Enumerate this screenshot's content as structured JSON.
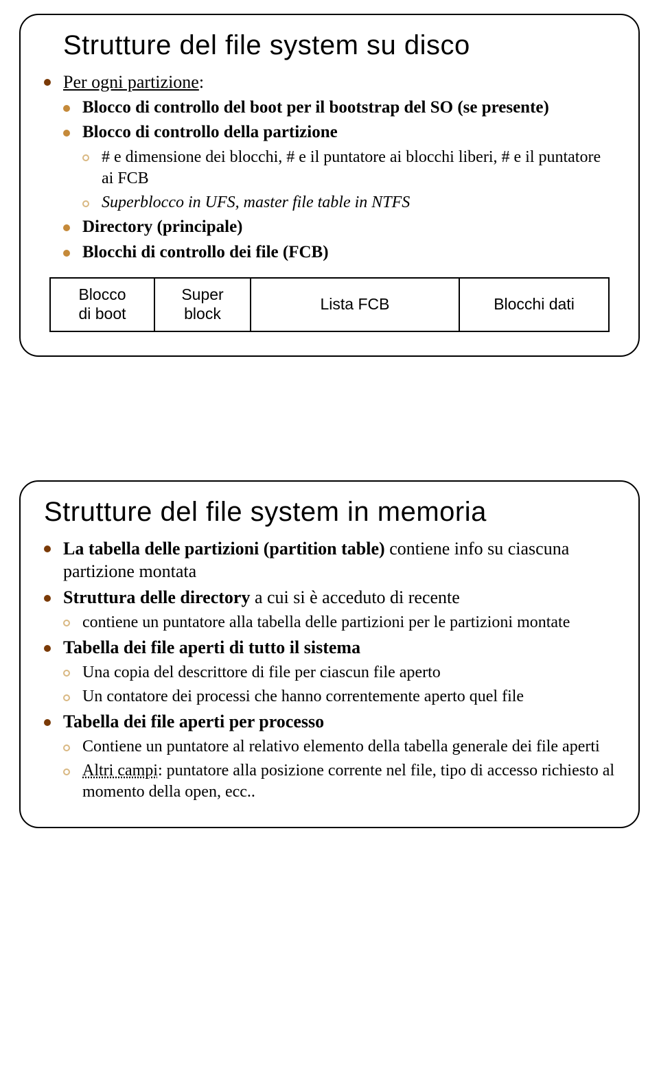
{
  "slide1": {
    "title": "Strutture del file system su disco",
    "l1_intro_prefix": "Per ogni partizione",
    "l1_intro_suffix": ":",
    "l2_boot": "Blocco di controllo del boot per il bootstrap del SO (se presente)",
    "l2_part": "Blocco di controllo della partizione",
    "l3_dims": "# e dimensione dei blocchi, # e il puntatore ai blocchi liberi, # e il puntatore ai FCB",
    "l3_superblock": "Superblocco in UFS, master file table in NTFS",
    "l2_dir": "Directory (principale)",
    "l2_fcb": "Blocchi di controllo dei file (FCB)",
    "disk": {
      "c1a": "Blocco",
      "c1b": "di boot",
      "c2a": "Super",
      "c2b": "block",
      "c3": "Lista FCB",
      "c4": "Blocchi dati"
    }
  },
  "slide2": {
    "title": "Strutture del file system in memoria",
    "l1_pt_bold": "La tabella delle partizioni (partition table)",
    "l1_pt_rest": " contiene  info su ciascuna partizione montata",
    "l1_dir_bold": "Struttura delle directory",
    "l1_dir_rest": " a cui si è acceduto di recente",
    "l2_dir_ptr": "contiene un puntatore alla tabella delle partizioni per le partizioni montate",
    "l1_sys": "Tabella dei file aperti di tutto il sistema",
    "l2_sys_copy": "Una copia del descrittore di file per ciascun file aperto",
    "l2_sys_count": "Un contatore dei processi che hanno correntemente aperto quel file",
    "l1_proc": "Tabella dei file aperti per processo",
    "l2_proc_ptr": "Contiene un puntatore al relativo elemento della tabella generale dei file aperti",
    "l2_proc_other_u": "Altri campi",
    "l2_proc_other_rest": ": puntatore alla posizione corrente nel file, tipo di accesso richiesto al momento della open, ecc.."
  }
}
